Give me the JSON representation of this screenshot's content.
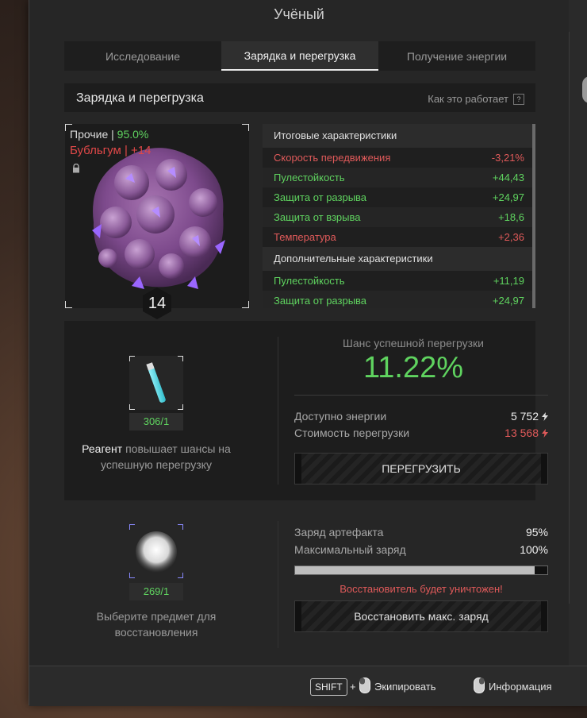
{
  "window": {
    "title": "Учёный"
  },
  "tabs": [
    {
      "label": "Исследование",
      "active": false
    },
    {
      "label": "Зарядка и перегрузка",
      "active": true
    },
    {
      "label": "Получение энергии",
      "active": false
    }
  ],
  "section": {
    "title": "Зарядка и перегрузка",
    "how_it_works": "Как это работает",
    "help_glyph": "?"
  },
  "artifact": {
    "durability_label": "Прочие |",
    "durability_value": "95.0%",
    "name": "Бубльгум | +14",
    "level": "14",
    "icon": "artifact-icon",
    "lock_icon": "lock-icon"
  },
  "stats": {
    "main_header": "Итоговые характеристики",
    "main": [
      {
        "name": "Скорость передвижения",
        "value": "-3,21%",
        "kind": "neg"
      },
      {
        "name": "Пулестойкость",
        "value": "+44,43",
        "kind": "pos"
      },
      {
        "name": "Защита от разрыва",
        "value": "+24,97",
        "kind": "pos"
      },
      {
        "name": "Защита от взрыва",
        "value": "+18,6",
        "kind": "pos"
      },
      {
        "name": "Температура",
        "value": "+2,36",
        "kind": "neg"
      }
    ],
    "extra_header": "Дополнительные характеристики",
    "extra": [
      {
        "name": "Пулестойкость",
        "value": "+11,19",
        "kind": "pos"
      },
      {
        "name": "Защита от разрыва",
        "value": "+24,97",
        "kind": "pos"
      }
    ]
  },
  "overload": {
    "reagent_count": "306/1",
    "reagent_highlight": "Реагент",
    "reagent_text": " повышает шансы на успешную перегрузку",
    "chance_label": "Шанс успешной перегрузки",
    "chance_value": "11.22%",
    "energy_label": "Доступно энергии",
    "energy_value": "5 752",
    "cost_label": "Стоимость перегрузки",
    "cost_value": "13 568",
    "button_label": "ПЕРЕГРУЗИТЬ"
  },
  "restore": {
    "item_count": "269/1",
    "select_text": "Выберите предмет для восстановления",
    "charge_label": "Заряд артефакта",
    "charge_value": "95%",
    "max_label": "Максимальный заряд",
    "max_value": "100%",
    "charge_fraction": 0.95,
    "warning": "Восстановитель будет уничтожен!",
    "button_label": "Восстановить макс. заряд"
  },
  "footer": {
    "shift_key": "SHIFT",
    "plus": "+",
    "equip_label": "Экипировать",
    "info_label": "Информация"
  },
  "colors": {
    "positive": "#5fd35f",
    "negative": "#e05a5a",
    "accent": "#e0e0e0"
  }
}
